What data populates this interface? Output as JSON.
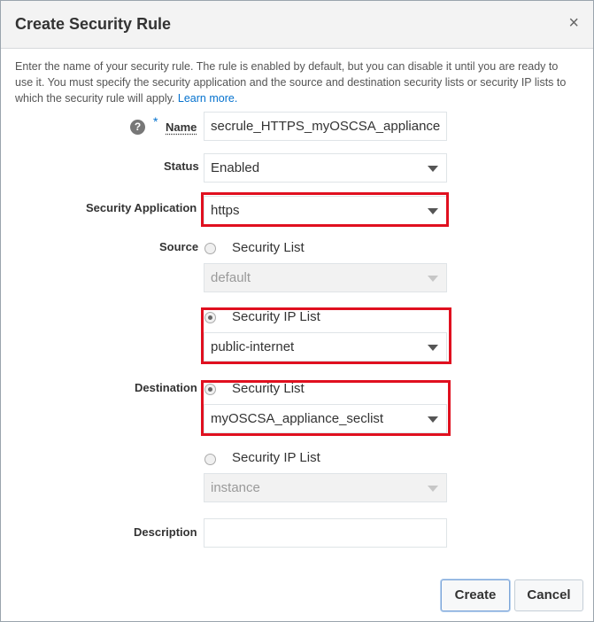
{
  "dialog": {
    "title": "Create Security Rule",
    "close_glyph": "×",
    "intro_text": "Enter the name of your security rule. The rule is enabled by default, but you can disable it until you are ready to use it. You must specify the security application and the source and destination security lists or security IP lists to which the security rule will apply.",
    "learn_more": "Learn more."
  },
  "form": {
    "help_glyph": "?",
    "required_mark": "*",
    "name_label": "Name",
    "name_value": "secrule_HTTPS_myOSCSA_appliance",
    "status_label": "Status",
    "status_value": "Enabled",
    "security_application_label": "Security Application",
    "security_application_value": "https",
    "source_label": "Source",
    "source_security_list_label": "Security List",
    "source_security_list_value": "default",
    "source_security_ip_list_label": "Security IP List",
    "source_security_ip_list_value": "public-internet",
    "destination_label": "Destination",
    "destination_security_list_label": "Security List",
    "destination_security_list_value": "myOSCSA_appliance_seclist",
    "destination_security_ip_list_label": "Security IP List",
    "destination_security_ip_list_value": "instance",
    "description_label": "Description",
    "description_value": ""
  },
  "buttons": {
    "create": "Create",
    "cancel": "Cancel"
  },
  "colors": {
    "highlight": "#e0101f",
    "link": "#0572ce"
  }
}
